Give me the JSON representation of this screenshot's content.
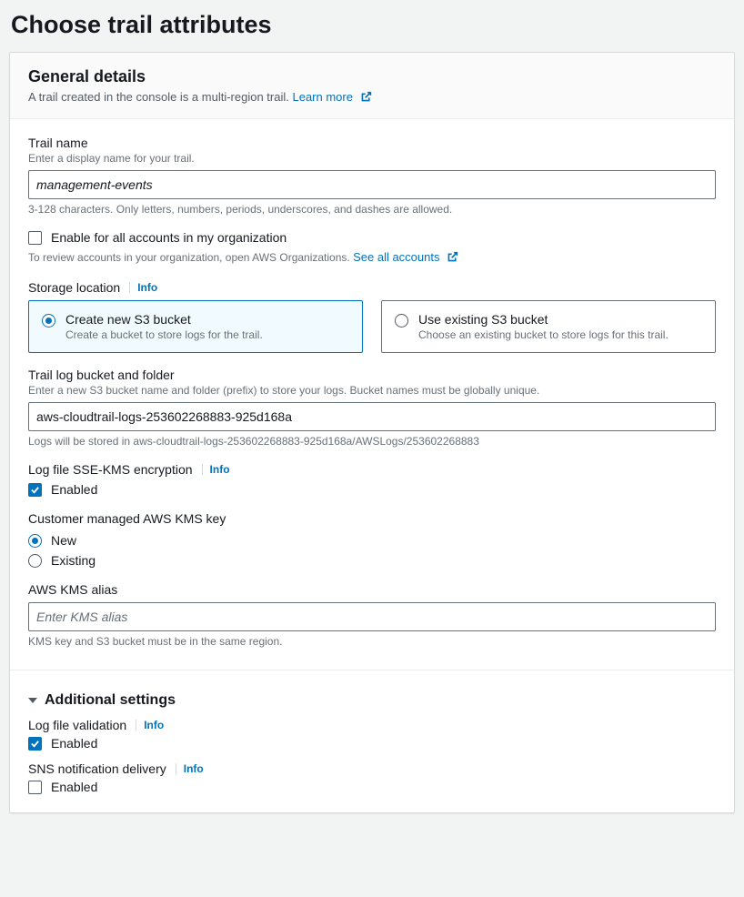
{
  "page_title": "Choose trail attributes",
  "general": {
    "heading": "General details",
    "subtext": "A trail created in the console is a multi-region trail.",
    "learn_more": "Learn more"
  },
  "trail_name": {
    "label": "Trail name",
    "hint": "Enter a display name for your trail.",
    "value": "management-events",
    "note": "3-128 characters. Only letters, numbers, periods, underscores, and dashes are allowed."
  },
  "org_enable": {
    "label": "Enable for all accounts in my organization",
    "hint_prefix": "To review accounts in your organization, open AWS Organizations.",
    "link": "See all accounts"
  },
  "storage": {
    "label": "Storage location",
    "info": "Info",
    "options": {
      "create": {
        "title": "Create new S3 bucket",
        "sub": "Create a bucket to store logs for the trail."
      },
      "existing": {
        "title": "Use existing S3 bucket",
        "sub": "Choose an existing bucket to store logs for this trail."
      }
    }
  },
  "bucket": {
    "label": "Trail log bucket and folder",
    "hint": "Enter a new S3 bucket name and folder (prefix) to store your logs. Bucket names must be globally unique.",
    "value": "aws-cloudtrail-logs-253602268883-925d168a",
    "note": "Logs will be stored in aws-cloudtrail-logs-253602268883-925d168a/AWSLogs/253602268883"
  },
  "sse_kms": {
    "label": "Log file SSE-KMS encryption",
    "info": "Info",
    "enabled_label": "Enabled"
  },
  "kms_key": {
    "label": "Customer managed AWS KMS key",
    "new": "New",
    "existing": "Existing"
  },
  "kms_alias": {
    "label": "AWS KMS alias",
    "placeholder": "Enter KMS alias",
    "note": "KMS key and S3 bucket must be in the same region."
  },
  "additional": {
    "heading": "Additional settings",
    "log_validation": {
      "label": "Log file validation",
      "info": "Info",
      "enabled_label": "Enabled"
    },
    "sns": {
      "label": "SNS notification delivery",
      "info": "Info",
      "enabled_label": "Enabled"
    }
  }
}
